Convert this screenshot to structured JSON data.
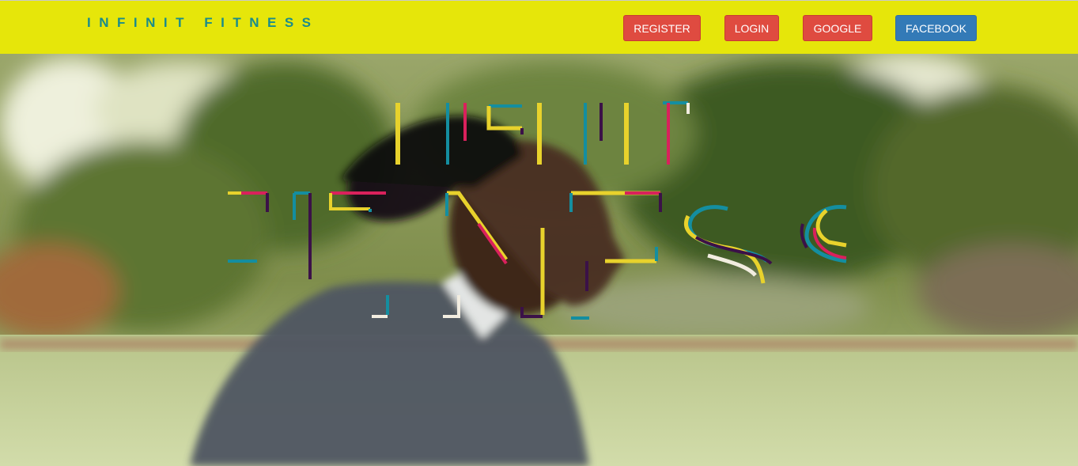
{
  "header": {
    "brand": "INFINIT FITNESS",
    "buttons": {
      "register": "REGISTER",
      "login": "LOGIN",
      "google": "GOOGLE",
      "facebook": "FACEBOOK"
    }
  },
  "colors": {
    "navbar": "#e6e60a",
    "brand_text": "#1a8c8c",
    "auth_button": "#df4b40",
    "facebook_button": "#337ab7",
    "lettering": [
      "#e8d22c",
      "#148ea0",
      "#d9215c",
      "#3b1148",
      "#f2ede0"
    ]
  },
  "hero": {
    "image": "woman-running-outdoors"
  }
}
